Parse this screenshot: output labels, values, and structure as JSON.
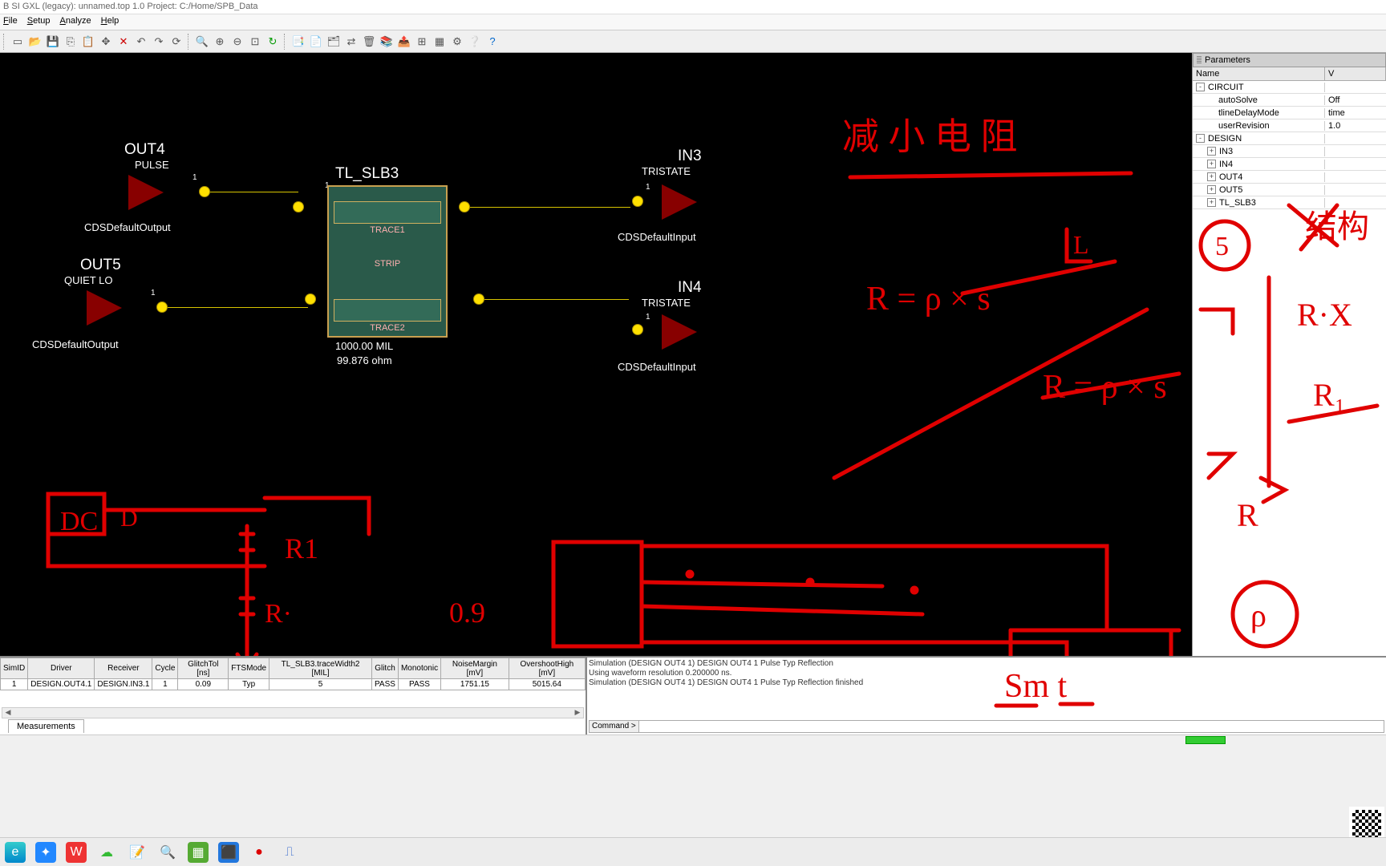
{
  "title": "B SI GXL (legacy): unnamed.top 1.0   Project:  C:/Home/SPB_Data",
  "menu": {
    "file": "File",
    "setup": "Setup",
    "analyze": "Analyze",
    "help": "Help"
  },
  "params": {
    "panel_title": "Parameters",
    "col_name": "Name",
    "col_val": "V",
    "rows": [
      {
        "indent": 0,
        "expander": "-",
        "name": "CIRCUIT",
        "val": ""
      },
      {
        "indent": 1,
        "expander": "",
        "name": "autoSolve",
        "val": "Off"
      },
      {
        "indent": 1,
        "expander": "",
        "name": "tlineDelayMode",
        "val": "time"
      },
      {
        "indent": 1,
        "expander": "",
        "name": "userRevision",
        "val": "1.0"
      },
      {
        "indent": 0,
        "expander": "-",
        "name": "DESIGN",
        "val": ""
      },
      {
        "indent": 1,
        "expander": "+",
        "name": "IN3",
        "val": ""
      },
      {
        "indent": 1,
        "expander": "+",
        "name": "IN4",
        "val": ""
      },
      {
        "indent": 1,
        "expander": "+",
        "name": "OUT4",
        "val": ""
      },
      {
        "indent": 1,
        "expander": "+",
        "name": "OUT5",
        "val": ""
      },
      {
        "indent": 1,
        "expander": "+",
        "name": "TL_SLB3",
        "val": ""
      }
    ]
  },
  "schematic": {
    "out4": {
      "name": "OUT4",
      "sub": "PULSE",
      "desc": "CDSDefaultOutput"
    },
    "out5": {
      "name": "OUT5",
      "sub": "QUIET LO",
      "desc": "CDSDefaultOutput"
    },
    "in3": {
      "name": "IN3",
      "sub": "TRISTATE",
      "desc": "CDSDefaultInput"
    },
    "in4": {
      "name": "IN4",
      "sub": "TRISTATE",
      "desc": "CDSDefaultInput"
    },
    "tl": {
      "name": "TL_SLB3",
      "trace1": "TRACE1",
      "strip": "STRIP",
      "trace2": "TRACE2",
      "len": "1000.00 MIL",
      "imp": "99.876 ohm"
    }
  },
  "table": {
    "headers": [
      "SimID",
      "Driver",
      "Receiver",
      "Cycle",
      "GlitchTol [ns]",
      "FTSMode",
      "TL_SLB3.traceWidth2 [MIL]",
      "Glitch",
      "Monotonic",
      "NoiseMargin [mV]",
      "OvershootHigh [mV]"
    ],
    "row": [
      "1",
      "DESIGN.OUT4.1",
      "DESIGN.IN3.1",
      "1",
      "0.09",
      "Typ",
      "5",
      "PASS",
      "PASS",
      "1751.15",
      "5015.64"
    ],
    "tab": "Measurements"
  },
  "log": {
    "l1": "Simulation (DESIGN OUT4 1) DESIGN OUT4 1 Pulse Typ Reflection",
    "l2": "Using waveform resolution 0.200000 ns.",
    "l3": "Simulation (DESIGN OUT4 1) DESIGN OUT4 1 Pulse Typ Reflection finished",
    "cmd_label": "Command >"
  },
  "anno": {
    "smt": "Sm t",
    "r1": "R1",
    "r2": "R·",
    "dc": "DC",
    "d": "D",
    "val09": "0.9",
    "req1": "R = ρ × s",
    "req2": "R = ρ × s",
    "L": "L",
    "top": "减 小 电 阻",
    "five": "5",
    "word": "结构",
    "rvx": "R·X",
    "ri": "R₁",
    "R": "R",
    "rho": "ρ"
  }
}
